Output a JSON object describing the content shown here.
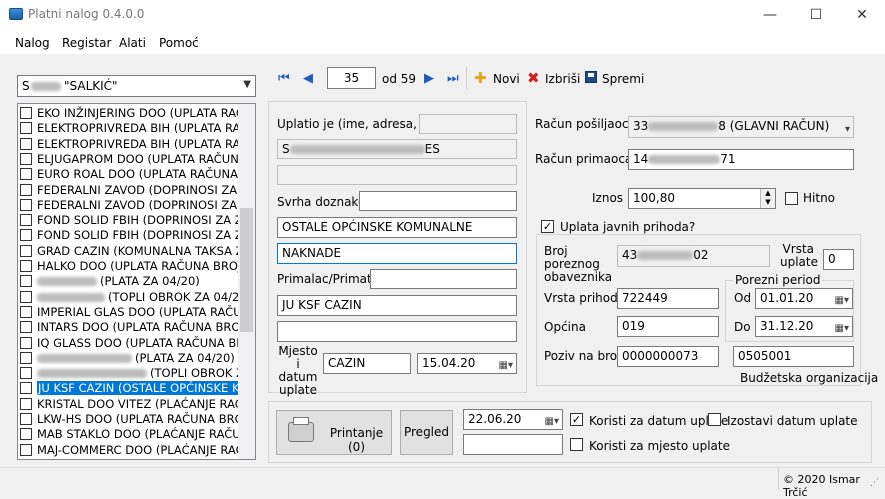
{
  "window": {
    "title": "Platni nalog 0.4.0.0",
    "minimize": "—",
    "maximize": "☐",
    "close": "✕"
  },
  "menu": [
    "Nalog",
    "Registar",
    "Alati",
    "Pomoć"
  ],
  "left": {
    "combo_value": "S",
    "combo_suffix": "\"SALKIĆ\"",
    "items": [
      {
        "text": "EKO INŽINJERING DOO (UPLATA RAČUN",
        "blur": 0
      },
      {
        "text": "ELEKTROPRIVREDA BIH (UPLATA RAČ",
        "blur": 0
      },
      {
        "text": "ELEKTROPRIVREDA BIH (UPLATA RAČ",
        "blur": 0
      },
      {
        "text": "ELJUGAPROM DOO (UPLATA RAČUNA",
        "blur": 0
      },
      {
        "text": "EURO ROAL DOO (UPLATA RAČUNA BI",
        "blur": 0
      },
      {
        "text": "FEDERALNI ZAVOD (DOPRINOSI ZA ZA",
        "blur": 0
      },
      {
        "text": "FEDERALNI ZAVOD (DOPRINOSI ZA ZA",
        "blur": 0
      },
      {
        "text": "FOND SOLID FBIH (DOPRINOSI ZA ZO",
        "blur": 0
      },
      {
        "text": "FOND SOLID FBIH (DOPRINOSI ZA ZO",
        "blur": 0
      },
      {
        "text": "GRAD CAZIN (KOMUNALNA TAKSA ZA",
        "blur": 0
      },
      {
        "text": "HALKO DOO (UPLATA RAČUNA BROJ",
        "blur": 0
      },
      {
        "text": "(PLATA ZA 04/20)",
        "blur": 60
      },
      {
        "text": "(TOPLI OBROK ZA 04/20)",
        "blur": 68
      },
      {
        "text": "IMPERIAL GLAS DOO (UPLATA RAČUNA",
        "blur": 0
      },
      {
        "text": "INTARS DOO (UPLATA RAČUNA BROJ",
        "blur": 0
      },
      {
        "text": "IQ GLASS DOO (UPLATA RAČUNA BRO",
        "blur": 0
      },
      {
        "text": "(PLATA ZA 04/20)",
        "blur": 95
      },
      {
        "text": "(TOPLI OBROK ZA",
        "blur": 110
      },
      {
        "text": "JU KSF CAZIN (OSTALE OPĆINSKE KO",
        "blur": 0
      },
      {
        "text": "KRISTAL DOO VITEZ (PLAĆANJE RAČU",
        "blur": 0
      },
      {
        "text": "LKW-HS DOO (UPLATA RAČUNA BROJ",
        "blur": 0
      },
      {
        "text": "MAB STAKLO DOO (PLAĆANJE RAČUNA",
        "blur": 0
      },
      {
        "text": "MAJ-COMMERC DOO (PLAĆANJE RAČU",
        "blur": 0
      }
    ],
    "selected_index": 18
  },
  "toolbar": {
    "current": "35",
    "of_label": "od 59",
    "new": "Novi",
    "delete": "Izbriši",
    "save": "Spremi"
  },
  "form": {
    "uplatio_label": "Uplatio je (ime, adresa, i tel.)",
    "uplatio_line1": "S",
    "uplatio_line1_end": "ES",
    "svrha_label": "Svrha doznake",
    "svrha_line1": "OSTALE OPĆINSKE KOMUNALNE",
    "svrha_line2": "NAKNADE",
    "primalac_label": "Primalac/Primatelj",
    "primalac_line1": "JU KSF CAZIN",
    "mjesto_label": "Mjesto i datum uplate",
    "mjesto": "CAZIN",
    "datum_uplate": "15.04.20",
    "racun_posiljaoca_label": "Račun pošiljaoca/ pošiljatelja",
    "racun_posiljaoca_start": "33",
    "racun_posiljaoca_end": "8 (GLAVNI RAČUN)",
    "racun_primaoca_label": "Račun primaoca/ primatelja",
    "racun_primaoca_start": "14",
    "racun_primaoca_end": "71",
    "iznos_label": "Iznos",
    "iznos": "100,80",
    "hitno_label": "Hitno",
    "uplata_jp_label": "Uplata javnih prihoda?",
    "broj_porezni_label": "Broj poreznog obaveznika",
    "broj_porezni_start": "43",
    "broj_porezni_end": "02",
    "vrsta_uplate_label": "Vrsta uplate",
    "vrsta_uplate": "0",
    "porezni_period_label": "Porezni period",
    "vrsta_prihoda_label": "Vrsta prihoda",
    "vrsta_prihoda": "722449",
    "od_label": "Od",
    "od": "01.01.20",
    "opcina_label": "Općina",
    "opcina": "019",
    "do_label": "Do",
    "do": "31.12.20",
    "poziv_label": "Poziv na broj",
    "poziv": "0000000073",
    "budzetska": "0505001",
    "budzetska_label": "Budžetska organizacija"
  },
  "print": {
    "print_label": "Printanje (0)",
    "pregled": "Pregled",
    "datum": "22.06.20",
    "koristi_datum": "Koristi za datum uplate",
    "izostavi_datum": "Izostavi datum uplate",
    "koristi_mjesto": "Koristi za mjesto uplate"
  },
  "status": "© 2020 Ismar Trčić",
  "colors": {
    "accent": "#0078d7",
    "nav_blue": "#1e5bbf",
    "new_icon": "#e8a317",
    "delete_icon": "#d11f1f"
  }
}
